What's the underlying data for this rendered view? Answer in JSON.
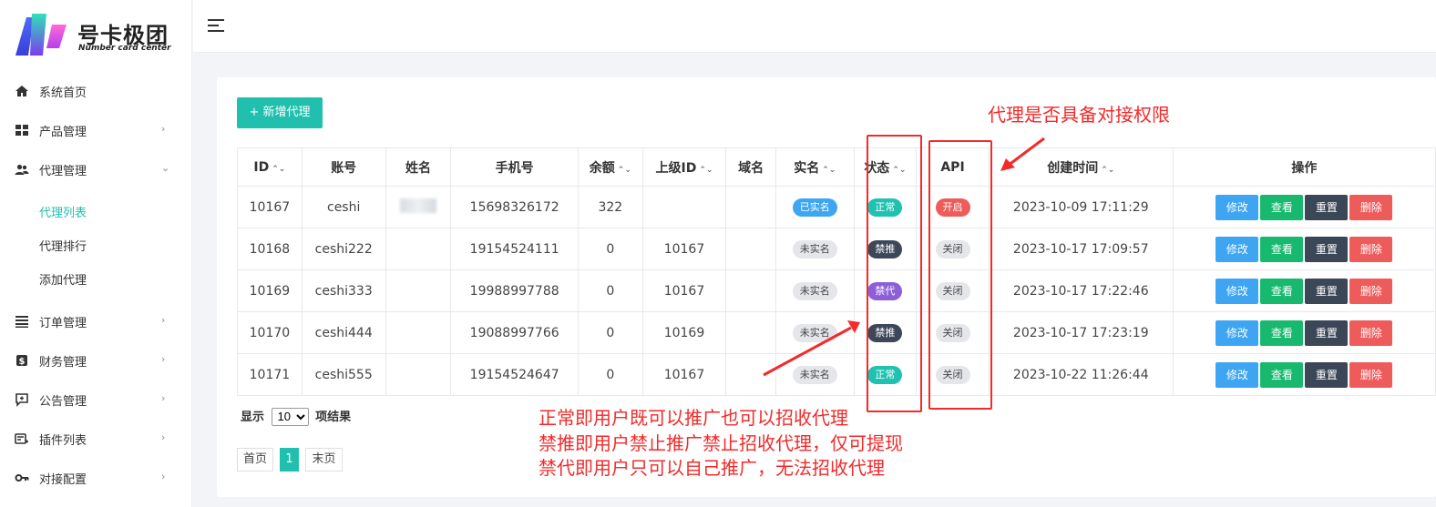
{
  "brand": {
    "title": "号卡极团",
    "subtitle": "Number card center"
  },
  "sidebar": {
    "items": [
      {
        "label": "系统首页",
        "icon": "home-icon",
        "chevron": ""
      },
      {
        "label": "产品管理",
        "icon": "grid-icon",
        "chevron": "›"
      },
      {
        "label": "代理管理",
        "icon": "users-icon",
        "chevron": "⌄"
      },
      {
        "label": "订单管理",
        "icon": "list-icon",
        "chevron": "›"
      },
      {
        "label": "财务管理",
        "icon": "dollar-icon",
        "chevron": "›"
      },
      {
        "label": "公告管理",
        "icon": "announcement-icon",
        "chevron": "›"
      },
      {
        "label": "插件列表",
        "icon": "plugin-icon",
        "chevron": "›"
      },
      {
        "label": "对接配置",
        "icon": "key-icon",
        "chevron": "›"
      }
    ],
    "sub_items": [
      {
        "label": "代理列表",
        "active": true
      },
      {
        "label": "代理排行",
        "active": false
      },
      {
        "label": "添加代理",
        "active": false
      }
    ]
  },
  "toolbar": {
    "add_label": "+ 新增代理"
  },
  "table": {
    "sort_glyph": "⌃⌄",
    "headers": [
      "ID",
      "账号",
      "姓名",
      "手机号",
      "余额",
      "上级ID",
      "域名",
      "实名",
      "状态",
      "API",
      "创建时间",
      "操作"
    ],
    "rows": [
      {
        "id": "10167",
        "account": "ceshi",
        "name": "",
        "phone": "15698326172",
        "balance": "322",
        "parent": "",
        "domain": "",
        "realname": "已实名",
        "status": "正常",
        "api": "开启",
        "created": "2023-10-09 17:11:29"
      },
      {
        "id": "10168",
        "account": "ceshi222",
        "name": "",
        "phone": "19154524111",
        "balance": "0",
        "parent": "10167",
        "domain": "",
        "realname": "未实名",
        "status": "禁推",
        "api": "关闭",
        "created": "2023-10-17 17:09:57"
      },
      {
        "id": "10169",
        "account": "ceshi333",
        "name": "",
        "phone": "19988997788",
        "balance": "0",
        "parent": "10167",
        "domain": "",
        "realname": "未实名",
        "status": "禁代",
        "api": "关闭",
        "created": "2023-10-17 17:22:46"
      },
      {
        "id": "10170",
        "account": "ceshi444",
        "name": "",
        "phone": "19088997766",
        "balance": "0",
        "parent": "10169",
        "domain": "",
        "realname": "未实名",
        "status": "禁推",
        "api": "关闭",
        "created": "2023-10-17 17:23:19"
      },
      {
        "id": "10171",
        "account": "ceshi555",
        "name": "",
        "phone": "19154524647",
        "balance": "0",
        "parent": "10167",
        "domain": "",
        "realname": "未实名",
        "status": "正常",
        "api": "关闭",
        "created": "2023-10-22 11:26:44"
      }
    ],
    "actions": {
      "edit": "修改",
      "view": "查看",
      "reset": "重置",
      "delete": "删除"
    }
  },
  "pagination": {
    "show_prefix": "显示",
    "page_size": "10",
    "show_suffix": "项结果",
    "first": "首页",
    "current": "1",
    "last": "末页"
  },
  "annotations": {
    "api_note": "代理是否具备对接权限",
    "status_note_1": "正常即用户既可以推广也可以招收代理",
    "status_note_2": "禁推即用户禁止推广禁止招收代理，仅可提现",
    "status_note_3": "禁代即用户只可以自己推广，无法招收代理",
    "color": "#f32a2a"
  },
  "colors": {
    "accent": "#21bfae",
    "edit": "#3ea5f3",
    "view": "#18b96e",
    "reset": "#3b4656",
    "delete": "#ee5b5b"
  }
}
